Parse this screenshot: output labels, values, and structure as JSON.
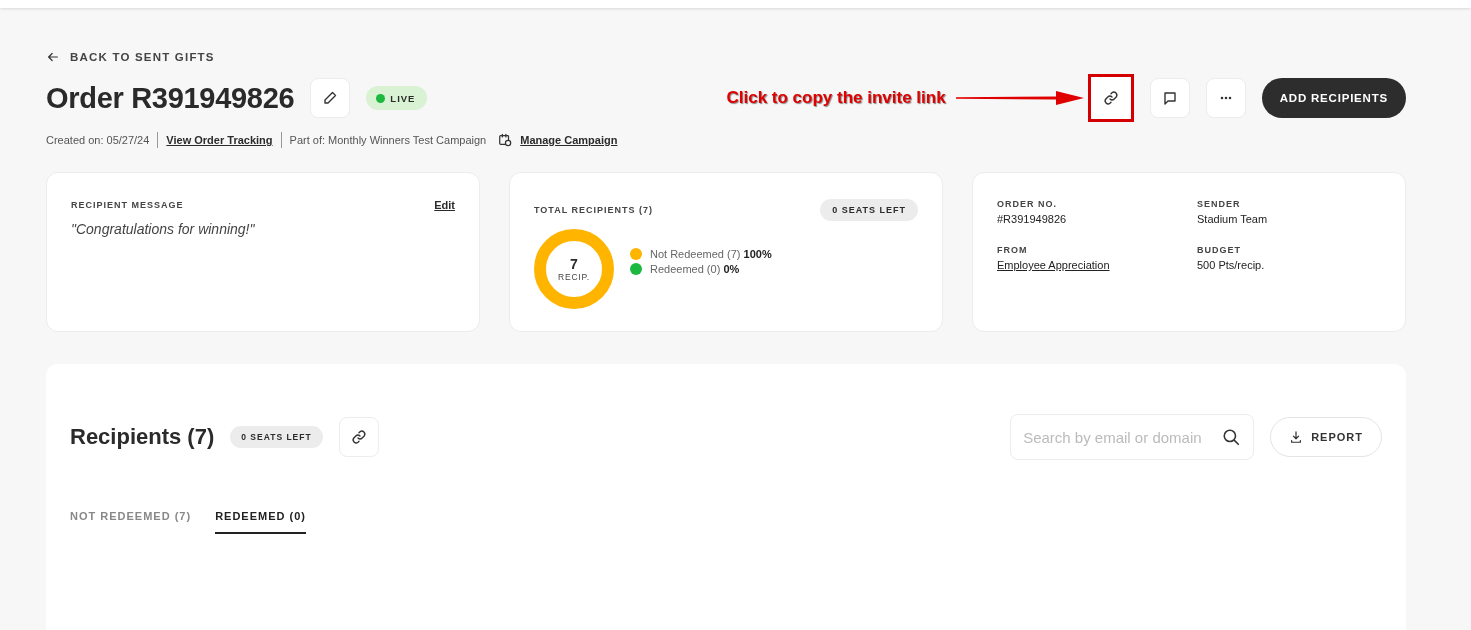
{
  "back_link": {
    "label": "BACK TO SENT GIFTS"
  },
  "header": {
    "title": "Order R391949826",
    "status": {
      "label": "LIVE",
      "color": "#1db83f"
    },
    "meta": [
      {
        "kind": "text",
        "text": "Created on: 05/27/24"
      },
      {
        "kind": "link",
        "text": "View Order Tracking"
      },
      {
        "kind": "text",
        "text": "Part of: Monthly Winners Test Campaign"
      },
      {
        "kind": "iconlink",
        "text": "Manage Campaign"
      }
    ],
    "primary_button": "ADD RECIPIENTS"
  },
  "annotation": {
    "text": "Click to copy the invite link"
  },
  "message_card": {
    "heading": "RECIPIENT MESSAGE",
    "edit": "Edit",
    "message": "\"Congratulations for winning!\""
  },
  "totals_card": {
    "heading": "TOTAL RECIPIENTS (7)",
    "badge": "0 SEATS LEFT",
    "center_value": "7",
    "center_label": "RECIP.",
    "legend": [
      {
        "label": "Not Redeemed (7)",
        "percent": "100%",
        "color": "#ffb400"
      },
      {
        "label": "Redeemed (0)",
        "percent": "0%",
        "color": "#1db83f"
      }
    ]
  },
  "details_card": {
    "fields": [
      {
        "kind": "text",
        "label": "ORDER NO.",
        "value": "#R391949826"
      },
      {
        "kind": "text",
        "label": "SENDER",
        "value": "Stadium Team"
      },
      {
        "kind": "link",
        "label": "FROM",
        "value": "Employee Appreciation"
      },
      {
        "kind": "text",
        "label": "BUDGET",
        "value": "500 Pts/recip."
      }
    ]
  },
  "recipients": {
    "title": "Recipients (7)",
    "badge": "0 SEATS LEFT",
    "search": {
      "placeholder": "Search by email or domain"
    },
    "report_button": "REPORT",
    "tabs": [
      {
        "label": "NOT REDEEMED (7)",
        "selected": false
      },
      {
        "label": "REDEEMED (0)",
        "selected": true
      }
    ]
  }
}
